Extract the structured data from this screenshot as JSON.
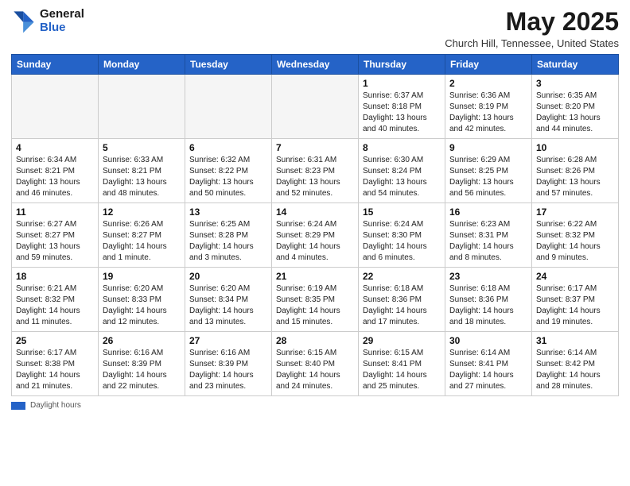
{
  "header": {
    "logo_general": "General",
    "logo_blue": "Blue",
    "month_title": "May 2025",
    "location": "Church Hill, Tennessee, United States"
  },
  "days_of_week": [
    "Sunday",
    "Monday",
    "Tuesday",
    "Wednesday",
    "Thursday",
    "Friday",
    "Saturday"
  ],
  "weeks": [
    [
      {
        "day": "",
        "empty": true
      },
      {
        "day": "",
        "empty": true
      },
      {
        "day": "",
        "empty": true
      },
      {
        "day": "",
        "empty": true
      },
      {
        "day": "1",
        "sunrise": "6:37 AM",
        "sunset": "8:18 PM",
        "daylight": "13 hours and 40 minutes."
      },
      {
        "day": "2",
        "sunrise": "6:36 AM",
        "sunset": "8:19 PM",
        "daylight": "13 hours and 42 minutes."
      },
      {
        "day": "3",
        "sunrise": "6:35 AM",
        "sunset": "8:20 PM",
        "daylight": "13 hours and 44 minutes."
      }
    ],
    [
      {
        "day": "4",
        "sunrise": "6:34 AM",
        "sunset": "8:21 PM",
        "daylight": "13 hours and 46 minutes."
      },
      {
        "day": "5",
        "sunrise": "6:33 AM",
        "sunset": "8:21 PM",
        "daylight": "13 hours and 48 minutes."
      },
      {
        "day": "6",
        "sunrise": "6:32 AM",
        "sunset": "8:22 PM",
        "daylight": "13 hours and 50 minutes."
      },
      {
        "day": "7",
        "sunrise": "6:31 AM",
        "sunset": "8:23 PM",
        "daylight": "13 hours and 52 minutes."
      },
      {
        "day": "8",
        "sunrise": "6:30 AM",
        "sunset": "8:24 PM",
        "daylight": "13 hours and 54 minutes."
      },
      {
        "day": "9",
        "sunrise": "6:29 AM",
        "sunset": "8:25 PM",
        "daylight": "13 hours and 56 minutes."
      },
      {
        "day": "10",
        "sunrise": "6:28 AM",
        "sunset": "8:26 PM",
        "daylight": "13 hours and 57 minutes."
      }
    ],
    [
      {
        "day": "11",
        "sunrise": "6:27 AM",
        "sunset": "8:27 PM",
        "daylight": "13 hours and 59 minutes."
      },
      {
        "day": "12",
        "sunrise": "6:26 AM",
        "sunset": "8:27 PM",
        "daylight": "14 hours and 1 minute."
      },
      {
        "day": "13",
        "sunrise": "6:25 AM",
        "sunset": "8:28 PM",
        "daylight": "14 hours and 3 minutes."
      },
      {
        "day": "14",
        "sunrise": "6:24 AM",
        "sunset": "8:29 PM",
        "daylight": "14 hours and 4 minutes."
      },
      {
        "day": "15",
        "sunrise": "6:24 AM",
        "sunset": "8:30 PM",
        "daylight": "14 hours and 6 minutes."
      },
      {
        "day": "16",
        "sunrise": "6:23 AM",
        "sunset": "8:31 PM",
        "daylight": "14 hours and 8 minutes."
      },
      {
        "day": "17",
        "sunrise": "6:22 AM",
        "sunset": "8:32 PM",
        "daylight": "14 hours and 9 minutes."
      }
    ],
    [
      {
        "day": "18",
        "sunrise": "6:21 AM",
        "sunset": "8:32 PM",
        "daylight": "14 hours and 11 minutes."
      },
      {
        "day": "19",
        "sunrise": "6:20 AM",
        "sunset": "8:33 PM",
        "daylight": "14 hours and 12 minutes."
      },
      {
        "day": "20",
        "sunrise": "6:20 AM",
        "sunset": "8:34 PM",
        "daylight": "14 hours and 13 minutes."
      },
      {
        "day": "21",
        "sunrise": "6:19 AM",
        "sunset": "8:35 PM",
        "daylight": "14 hours and 15 minutes."
      },
      {
        "day": "22",
        "sunrise": "6:18 AM",
        "sunset": "8:36 PM",
        "daylight": "14 hours and 17 minutes."
      },
      {
        "day": "23",
        "sunrise": "6:18 AM",
        "sunset": "8:36 PM",
        "daylight": "14 hours and 18 minutes."
      },
      {
        "day": "24",
        "sunrise": "6:17 AM",
        "sunset": "8:37 PM",
        "daylight": "14 hours and 19 minutes."
      }
    ],
    [
      {
        "day": "25",
        "sunrise": "6:17 AM",
        "sunset": "8:38 PM",
        "daylight": "14 hours and 21 minutes."
      },
      {
        "day": "26",
        "sunrise": "6:16 AM",
        "sunset": "8:39 PM",
        "daylight": "14 hours and 22 minutes."
      },
      {
        "day": "27",
        "sunrise": "6:16 AM",
        "sunset": "8:39 PM",
        "daylight": "14 hours and 23 minutes."
      },
      {
        "day": "28",
        "sunrise": "6:15 AM",
        "sunset": "8:40 PM",
        "daylight": "14 hours and 24 minutes."
      },
      {
        "day": "29",
        "sunrise": "6:15 AM",
        "sunset": "8:41 PM",
        "daylight": "14 hours and 25 minutes."
      },
      {
        "day": "30",
        "sunrise": "6:14 AM",
        "sunset": "8:41 PM",
        "daylight": "14 hours and 27 minutes."
      },
      {
        "day": "31",
        "sunrise": "6:14 AM",
        "sunset": "8:42 PM",
        "daylight": "14 hours and 28 minutes."
      }
    ]
  ],
  "footer": {
    "daylight_label": "Daylight hours"
  }
}
